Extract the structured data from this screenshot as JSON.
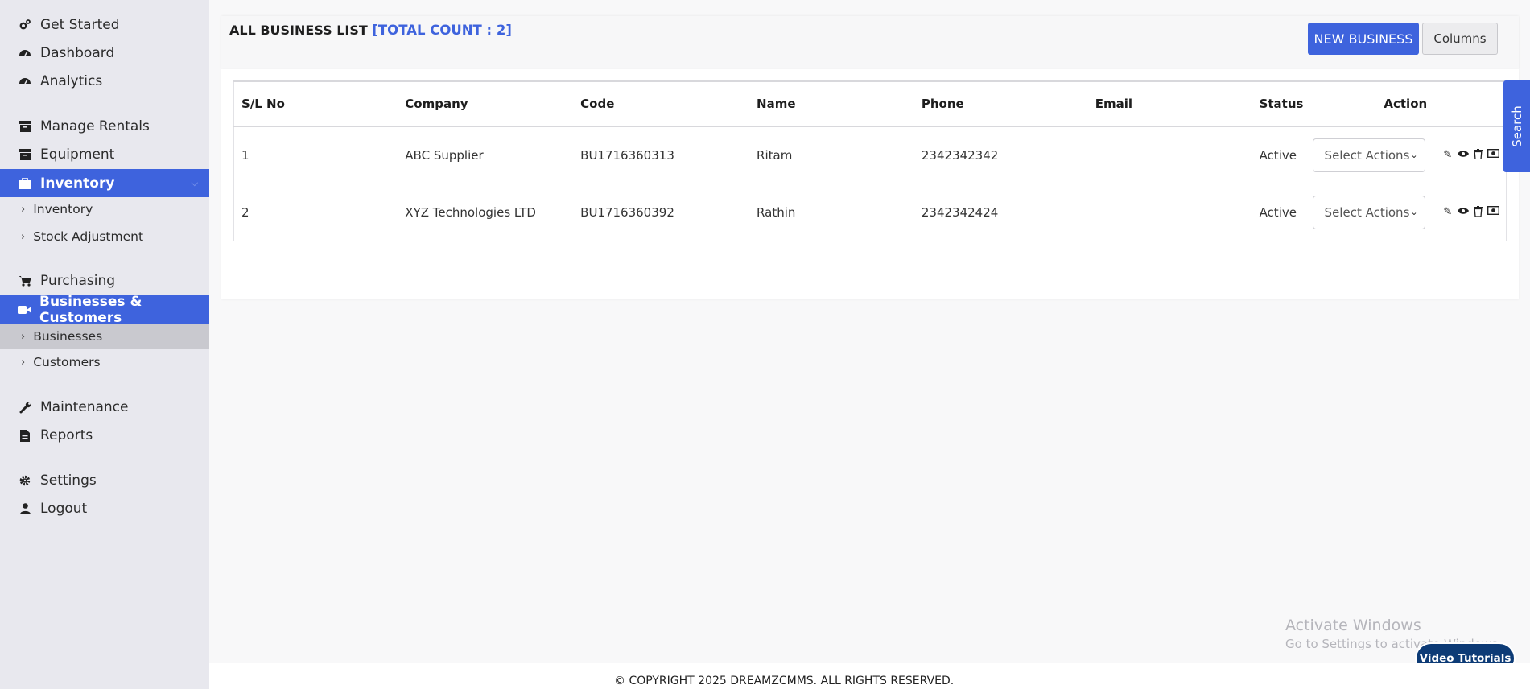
{
  "sidebar": {
    "get_started": "Get Started",
    "dashboard": "Dashboard",
    "analytics": "Analytics",
    "manage_rentals": "Manage Rentals",
    "equipment": "Equipment",
    "inventory": "Inventory",
    "inventory_sub": "Inventory",
    "stock_adjustment": "Stock Adjustment",
    "purchasing": "Purchasing",
    "businesses_customers": "Businesses & Customers",
    "businesses": "Businesses",
    "customers": "Customers",
    "maintenance": "Maintenance",
    "reports": "Reports",
    "settings": "Settings",
    "logout": "Logout"
  },
  "header": {
    "title": "ALL BUSINESS LIST",
    "count": "[TOTAL COUNT : 2]",
    "new_button": "NEW BUSINESS",
    "columns_button": "Columns"
  },
  "table": {
    "columns": [
      "S/L No",
      "Company",
      "Code",
      "Name",
      "Phone",
      "Email",
      "Status",
      "Action"
    ],
    "rows": [
      {
        "sl": "1",
        "company": "ABC Supplier",
        "code": "BU1716360313",
        "name": "Ritam",
        "phone": "2342342342",
        "email": "",
        "status": "Active"
      },
      {
        "sl": "2",
        "company": "XYZ Technologies LTD",
        "code": "BU1716360392",
        "name": "Rathin",
        "phone": "2342342424",
        "email": "",
        "status": "Active"
      }
    ],
    "select_placeholder": "Select Actions"
  },
  "search_tab": "Search",
  "watermark": {
    "line1": "Activate Windows",
    "line2": "Go to Settings to activate Windows."
  },
  "video_tutorials": "Video Tutorials",
  "footer": "© COPYRIGHT 2025 DREAMZCMMS. ALL RIGHTS RESERVED.",
  "colors": {
    "accent": "#3e63dd",
    "sidebar_bg": "#e8e8ee",
    "video_button": "#0d3b76"
  }
}
